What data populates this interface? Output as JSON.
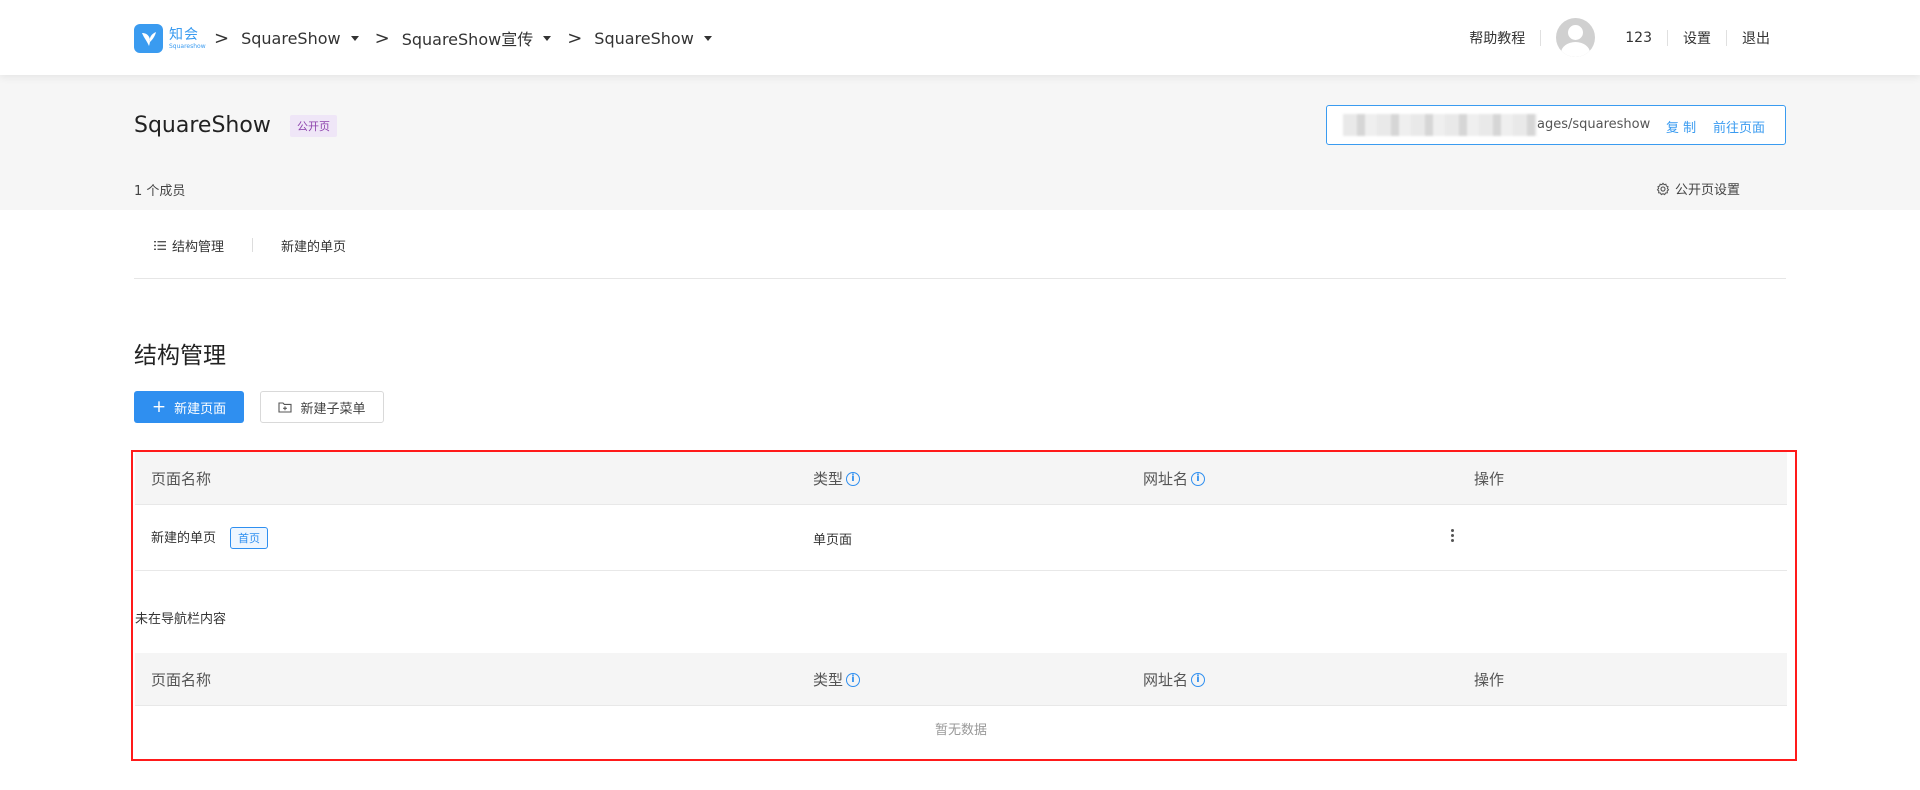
{
  "logo": {
    "name_cn": "知会",
    "name_en": "Squareshow"
  },
  "breadcrumbs": [
    "SquareShow",
    "SquareShow宣传",
    "SquareShow"
  ],
  "topnav": {
    "help": "帮助教程",
    "username": "123",
    "settings": "设置",
    "logout": "退出"
  },
  "header": {
    "title": "SquareShow",
    "tag": "公开页",
    "url_text": "ages/squareshow",
    "copy_label": "复 制",
    "goto_label": "前往页面",
    "members": "1 个成员",
    "page_settings": "公开页设置"
  },
  "tabs": [
    "结构管理",
    "新建的单页"
  ],
  "section": {
    "title": "结构管理",
    "new_page": "新建页面",
    "new_submenu": "新建子菜单"
  },
  "table": {
    "columns": [
      "页面名称",
      "类型",
      "网址名",
      "操作"
    ],
    "rows": [
      {
        "name": "新建的单页",
        "badge": "首页",
        "type": "单页面",
        "url": ""
      }
    ],
    "not_in_nav_label": "未在导航栏内容",
    "empty_text": "暂无数据"
  },
  "colors": {
    "primary": "#2f8ff0",
    "tag_purple": "#8e44ad",
    "highlight_border": "#ff1a1a"
  }
}
